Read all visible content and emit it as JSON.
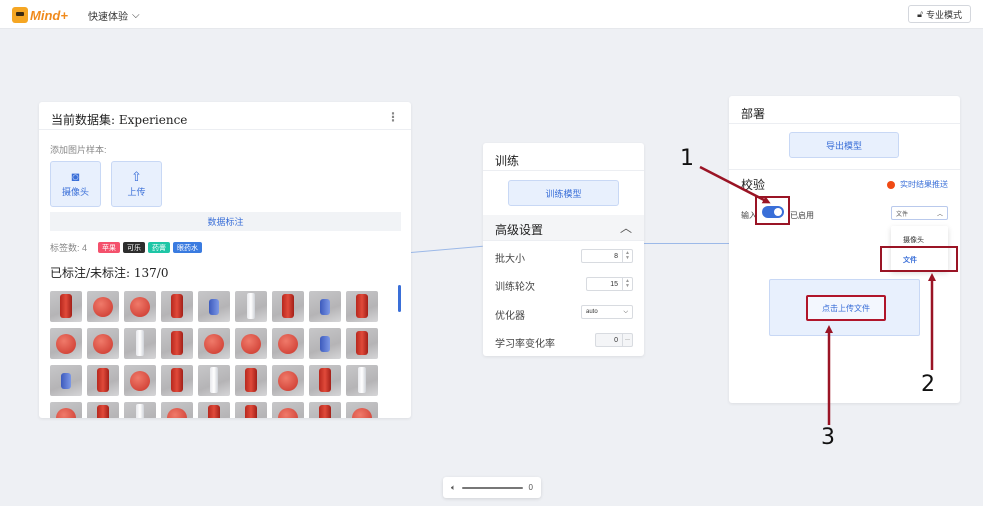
{
  "topbar": {
    "logo_text": "Mind+",
    "quick_menu": "快速体验",
    "pro_mode": "专业模式"
  },
  "dataset": {
    "title": "当前数据集: Experience",
    "add_samples_label": "添加图片样本:",
    "camera_button": "摄像头",
    "upload_button": "上传",
    "label_data_button": "数据标注",
    "tag_count_label": "标签数: 4",
    "tags": [
      {
        "label": "苹果",
        "color": "#f4516c"
      },
      {
        "label": "可乐",
        "color": "#2d2d2d"
      },
      {
        "label": "药膏",
        "color": "#1ec6a6"
      },
      {
        "label": "眼药水",
        "color": "#3a7be0"
      }
    ],
    "labeled_summary": "已标注/未标注: 137/0"
  },
  "training": {
    "title": "训练",
    "train_button": "训练模型",
    "advanced_title": "高级设置",
    "batch_size_label": "批大小",
    "batch_size_value": "8",
    "epochs_label": "训练轮次",
    "epochs_value": "15",
    "optimizer_label": "优化器",
    "optimizer_value": "auto",
    "lr_label": "学习率变化率",
    "lr_value": "0"
  },
  "deploy": {
    "title": "部署",
    "export_button": "导出模型",
    "verify_title": "校验",
    "realtime_label": "实时结果推送",
    "input_label": "输入",
    "enabled_label": "已启用",
    "source_select_value": "文件",
    "source_options": [
      "摄像头",
      "文件"
    ],
    "upload_file_button": "点击上传文件"
  },
  "annotations": {
    "n1": "1",
    "n2": "2",
    "n3": "3",
    "color": "#9a1425"
  },
  "player": {
    "volume_icon": "speaker-icon",
    "value": "0"
  },
  "colors": {
    "accent": "#3a6fd8",
    "record_dot": "#f04a14"
  }
}
